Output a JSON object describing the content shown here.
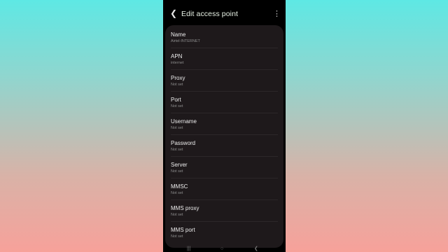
{
  "header": {
    "title": "Edit access point",
    "back_icon": "back-arrow-icon",
    "more_icon": "more-vertical-icon"
  },
  "fields": [
    {
      "label": "Name",
      "value": "Airtel-INTERNET"
    },
    {
      "label": "APN",
      "value": "internet"
    },
    {
      "label": "Proxy",
      "value": "Not set"
    },
    {
      "label": "Port",
      "value": "Not set"
    },
    {
      "label": "Username",
      "value": "Not set"
    },
    {
      "label": "Password",
      "value": "Not set"
    },
    {
      "label": "Server",
      "value": "Not set"
    },
    {
      "label": "MMSC",
      "value": "Not set"
    },
    {
      "label": "MMS proxy",
      "value": "Not set"
    },
    {
      "label": "MMS port",
      "value": "Not set"
    }
  ],
  "colors": {
    "background_top": "#5ee8e4",
    "background_bottom": "#f7a19a",
    "card": "#1e191b",
    "title": "#e8f2e6"
  }
}
